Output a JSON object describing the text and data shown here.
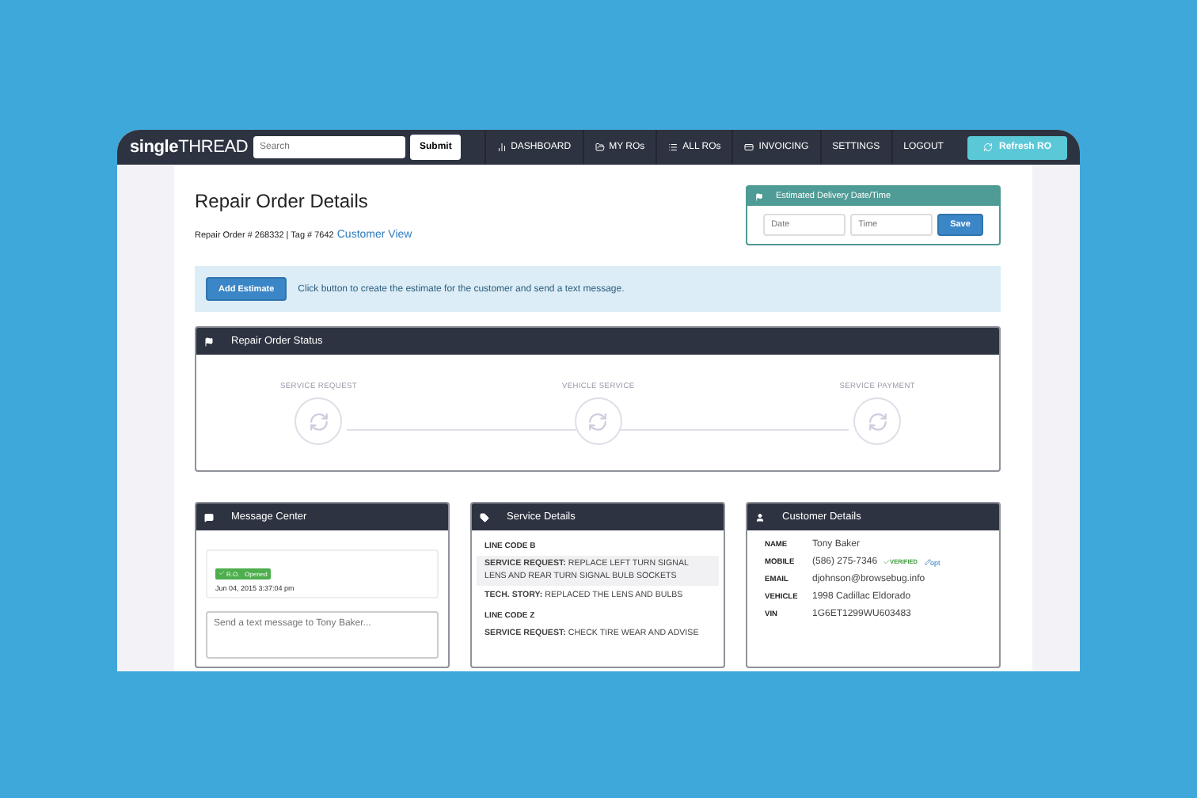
{
  "nav": {
    "logo": "**single**THREAD",
    "search": {
      "placeholder": "Search"
    },
    "submit": "Submit",
    "items": [
      {
        "label": "DASHBOARD"
      },
      {
        "label": "MY ROs"
      },
      {
        "label": "ALL ROs"
      },
      {
        "label": "INVOICING"
      },
      {
        "label": "SETTINGS"
      },
      {
        "label": "LOGOUT"
      }
    ],
    "refresh": "Refresh RO"
  },
  "header": {
    "title": "Repair Order Details",
    "meta": "Repair Order # 268332 | Tag # 7642",
    "link": "Customer View"
  },
  "delivery": {
    "title": "Estimated Delivery Date/Time",
    "date": {
      "placeholder": "Date"
    },
    "time": {
      "placeholder": "Time"
    },
    "save": "Save"
  },
  "notice": {
    "button": "Add Estimate",
    "text": "Click button to create the estimate for the customer and send a text message."
  },
  "status": {
    "title": "Repair Order Status",
    "steps": [
      {
        "label": "SERVICE REQUEST"
      },
      {
        "label": "VEHICLE SERVICE"
      },
      {
        "label": "SERVICE PAYMENT"
      }
    ]
  },
  "messages": {
    "title": "Message Center",
    "items": [
      {
        "badge": "R.O.   Opened",
        "time": "Jun 04, 2015 3:37:04 pm"
      }
    ],
    "input": {
      "placeholder": "Send a text message to Tony Baker..."
    }
  },
  "service": {
    "title": "Service Details",
    "lines": [
      {
        "kind": "code",
        "text": "LINE CODE B"
      },
      {
        "kind": "entry",
        "label": "SERVICE REQUEST:",
        "text": "REPLACE LEFT TURN SIGNAL LENS AND REAR TURN SIGNAL BULB SOCKETS",
        "shaded": true
      },
      {
        "kind": "entry",
        "label": "TECH. STORY:",
        "text": "REPLACED THE LENS AND BULBS",
        "shaded": false
      },
      {
        "kind": "code",
        "text": "LINE CODE Z"
      },
      {
        "kind": "entry",
        "label": "SERVICE REQUEST:",
        "text": "CHECK TIRE WEAR AND ADVISE",
        "shaded": false
      }
    ]
  },
  "customer": {
    "title": "Customer Details",
    "rows": [
      {
        "label": "NAME",
        "value": "Tony Baker"
      },
      {
        "label": "MOBILE",
        "value": "(586) 275-7346",
        "tag": "VERIFIED",
        "link": "opt"
      },
      {
        "label": "EMAIL",
        "value": "djohnson@browsebug.info"
      },
      {
        "label": "VEHICLE",
        "value": "1998 Cadillac Eldorado"
      },
      {
        "label": "VIN",
        "value": "1G6ET1299WU603483"
      }
    ]
  }
}
